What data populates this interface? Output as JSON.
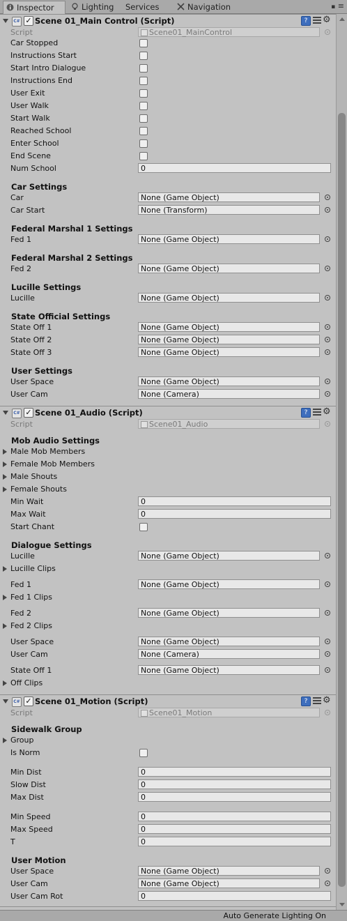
{
  "tabs": [
    {
      "label": "Inspector",
      "icon": "info-icon",
      "active": true
    },
    {
      "label": "Lighting",
      "icon": "bulb-icon",
      "active": false
    },
    {
      "label": "Services",
      "icon": "",
      "active": false
    },
    {
      "label": "Navigation",
      "icon": "compass-icon",
      "active": false
    }
  ],
  "tab_menu": "≡",
  "components": [
    {
      "key": "main",
      "title": "Scene 01_Main Control (Script)",
      "script_label": "Script",
      "script_value": "Scene01_MainControl",
      "rows": [
        {
          "kind": "check",
          "label": "Car Stopped"
        },
        {
          "kind": "check",
          "label": "Instructions Start"
        },
        {
          "kind": "check",
          "label": "Start Intro Dialogue"
        },
        {
          "kind": "check",
          "label": "Instructions End"
        },
        {
          "kind": "check",
          "label": "User Exit"
        },
        {
          "kind": "check",
          "label": "User Walk"
        },
        {
          "kind": "check",
          "label": "Start Walk"
        },
        {
          "kind": "check",
          "label": "Reached School"
        },
        {
          "kind": "check",
          "label": "Enter School"
        },
        {
          "kind": "check",
          "label": "End Scene"
        },
        {
          "kind": "num",
          "label": "Num School",
          "value": "0"
        },
        {
          "kind": "section",
          "label": "Car Settings"
        },
        {
          "kind": "obj",
          "label": "Car",
          "value": "None (Game Object)"
        },
        {
          "kind": "obj",
          "label": "Car Start",
          "value": "None (Transform)"
        },
        {
          "kind": "section",
          "label": "Federal Marshal 1 Settings"
        },
        {
          "kind": "obj",
          "label": "Fed 1",
          "value": "None (Game Object)"
        },
        {
          "kind": "section",
          "label": "Federal Marshal 2 Settings"
        },
        {
          "kind": "obj",
          "label": "Fed 2",
          "value": "None (Game Object)"
        },
        {
          "kind": "section",
          "label": "Lucille Settings"
        },
        {
          "kind": "obj",
          "label": "Lucille",
          "value": "None (Game Object)"
        },
        {
          "kind": "section",
          "label": "State Official Settings"
        },
        {
          "kind": "obj",
          "label": "State Off 1",
          "value": "None (Game Object)"
        },
        {
          "kind": "obj",
          "label": "State Off 2",
          "value": "None (Game Object)"
        },
        {
          "kind": "obj",
          "label": "State Off 3",
          "value": "None (Game Object)"
        },
        {
          "kind": "section",
          "label": "User Settings"
        },
        {
          "kind": "obj",
          "label": "User Space",
          "value": "None (Game Object)"
        },
        {
          "kind": "obj",
          "label": "User Cam",
          "value": "None (Camera)"
        }
      ]
    },
    {
      "key": "audio",
      "title": "Scene 01_Audio (Script)",
      "script_label": "Script",
      "script_value": "Scene01_Audio",
      "rows": [
        {
          "kind": "section",
          "label": "Mob Audio Settings"
        },
        {
          "kind": "fold",
          "label": "Male Mob Members"
        },
        {
          "kind": "fold",
          "label": "Female Mob Members"
        },
        {
          "kind": "fold",
          "label": "Male Shouts"
        },
        {
          "kind": "fold",
          "label": "Female Shouts"
        },
        {
          "kind": "num",
          "label": "Min Wait",
          "value": "0"
        },
        {
          "kind": "num",
          "label": "Max Wait",
          "value": "0"
        },
        {
          "kind": "check",
          "label": "Start Chant"
        },
        {
          "kind": "section",
          "label": "Dialogue Settings"
        },
        {
          "kind": "obj",
          "label": "Lucille",
          "value": "None (Game Object)"
        },
        {
          "kind": "fold",
          "label": "Lucille Clips"
        },
        {
          "kind": "obj",
          "label": "Fed 1",
          "value": "None (Game Object)"
        },
        {
          "kind": "fold",
          "label": "Fed 1 Clips"
        },
        {
          "kind": "obj",
          "label": "Fed 2",
          "value": "None (Game Object)"
        },
        {
          "kind": "fold",
          "label": "Fed 2 Clips"
        },
        {
          "kind": "obj",
          "label": "User Space",
          "value": "None (Game Object)"
        },
        {
          "kind": "obj",
          "label": "User Cam",
          "value": "None (Camera)"
        },
        {
          "kind": "obj",
          "label": "State Off 1",
          "value": "None (Game Object)"
        },
        {
          "kind": "fold",
          "label": "Off Clips"
        }
      ]
    },
    {
      "key": "motion",
      "title": "Scene 01_Motion (Script)",
      "script_label": "Script",
      "script_value": "Scene01_Motion",
      "rows": [
        {
          "kind": "section",
          "label": "Sidewalk Group"
        },
        {
          "kind": "fold",
          "label": "Group"
        },
        {
          "kind": "check",
          "label": "Is Norm"
        },
        {
          "kind": "num",
          "label": "Min Dist",
          "value": "0"
        },
        {
          "kind": "num",
          "label": "Slow Dist",
          "value": "0"
        },
        {
          "kind": "num",
          "label": "Max Dist",
          "value": "0"
        },
        {
          "kind": "num",
          "label": "Min Speed",
          "value": "0"
        },
        {
          "kind": "num",
          "label": "Max Speed",
          "value": "0"
        },
        {
          "kind": "num",
          "label": "T",
          "value": "0"
        },
        {
          "kind": "section",
          "label": "User Motion"
        },
        {
          "kind": "obj",
          "label": "User Space",
          "value": "None (Game Object)"
        },
        {
          "kind": "obj",
          "label": "User Cam",
          "value": "None (Game Object)"
        },
        {
          "kind": "num",
          "label": "User Cam Rot",
          "value": "0"
        }
      ]
    }
  ],
  "footer": {
    "status": "Auto Generate Lighting On"
  }
}
